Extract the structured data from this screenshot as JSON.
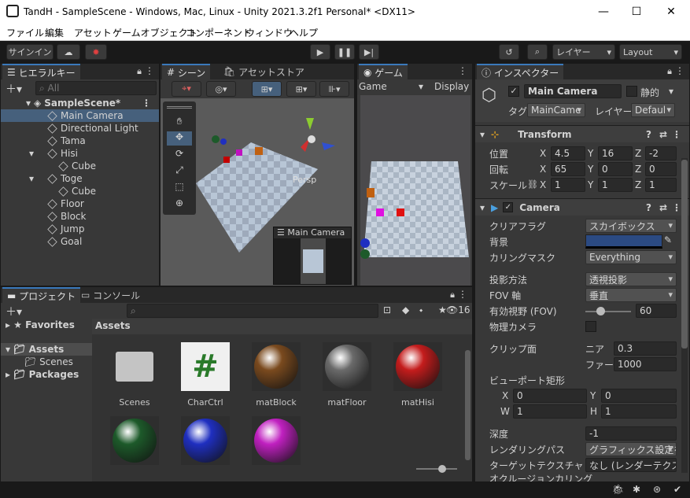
{
  "window": {
    "title": "TandH - SampleScene - Windows, Mac, Linux - Unity 2021.3.2f1 Personal* <DX11>",
    "minimize": "—",
    "maximize": "☐",
    "close": "✕"
  },
  "menu": [
    "ファイル",
    "編集",
    "アセット",
    "ゲームオブジェクト",
    "コンポーネント",
    "ウィンドウ",
    "ヘルプ"
  ],
  "toolbar": {
    "signin": "サインイン",
    "layers": "レイヤー",
    "layout": "Layout"
  },
  "hierarchy": {
    "tab": "ヒエラルキー",
    "search_placeholder": "All",
    "scene": "SampleScene*",
    "items": [
      {
        "label": "Main Camera",
        "indent": 1,
        "selected": true
      },
      {
        "label": "Directional Light",
        "indent": 1
      },
      {
        "label": "Tama",
        "indent": 1
      },
      {
        "label": "Hisi",
        "indent": 1,
        "expanded": true
      },
      {
        "label": "Cube",
        "indent": 2
      },
      {
        "label": "Toge",
        "indent": 1,
        "expanded": true
      },
      {
        "label": "Cube",
        "indent": 2
      },
      {
        "label": "Floor",
        "indent": 1
      },
      {
        "label": "Block",
        "indent": 1
      },
      {
        "label": "Jump",
        "indent": 1
      },
      {
        "label": "Goal",
        "indent": 1
      }
    ]
  },
  "scene": {
    "tab_scene": "シーン",
    "tab_store": "アセットストア",
    "persp": "Persp",
    "overlay_title": "Main Camera"
  },
  "game": {
    "tab": "ゲーム",
    "display_mode": "Game",
    "display": "Display"
  },
  "inspector": {
    "tab": "インスペクター",
    "object_name": "Main Camera",
    "static_label": "静的",
    "tag_label": "タグ",
    "tag_value": "MainCame",
    "layer_label": "レイヤー",
    "layer_value": "Defaul",
    "transform": {
      "title": "Transform",
      "position": {
        "label": "位置",
        "x": "4.5",
        "y": "16",
        "z": "-2"
      },
      "rotation": {
        "label": "回転",
        "x": "65",
        "y": "0",
        "z": "0"
      },
      "scale": {
        "label": "スケール",
        "x": "1",
        "y": "1",
        "z": "1"
      }
    },
    "camera": {
      "title": "Camera",
      "clear_flags": {
        "label": "クリアフラグ",
        "value": "スカイボックス"
      },
      "background": {
        "label": "背景",
        "color": "#2b4a82"
      },
      "culling_mask": {
        "label": "カリングマスク",
        "value": "Everything"
      },
      "projection": {
        "label": "投影方法",
        "value": "透視投影"
      },
      "fov_axis": {
        "label": "FOV 軸",
        "value": "垂直"
      },
      "fov": {
        "label": "有効視野 (FOV)",
        "value": "60"
      },
      "physical": {
        "label": "物理カメラ"
      },
      "clipping": {
        "label": "クリップ面",
        "near_label": "ニア",
        "near": "0.3",
        "far_label": "ファー",
        "far": "1000"
      },
      "viewport": {
        "label": "ビューポート矩形",
        "x": "0",
        "y": "0",
        "w": "1",
        "h": "1"
      },
      "depth": {
        "label": "深度",
        "value": "-1"
      },
      "render_path": {
        "label": "レンダリングパス",
        "value": "グラフィックス設定を使"
      },
      "target_texture": {
        "label": "ターゲットテクスチャ",
        "value": "なし (レンダーテクスチ"
      },
      "occlusion": {
        "label": "オクルージョンカリング"
      }
    }
  },
  "project": {
    "tab_project": "プロジェクト",
    "tab_console": "コンソール",
    "hidden_count": "16",
    "tree": [
      {
        "label": "Favorites",
        "bold": true
      },
      {
        "label": "Assets",
        "bold": true,
        "selected": true
      },
      {
        "label": "Scenes",
        "indent": 1
      },
      {
        "label": "Packages",
        "bold": true
      }
    ],
    "breadcrumb": "Assets",
    "assets": [
      {
        "name": "Scenes",
        "kind": "folder"
      },
      {
        "name": "CharCtrl",
        "kind": "script"
      },
      {
        "name": "matBlock",
        "kind": "sphere",
        "color": "#7a4a1e"
      },
      {
        "name": "matFloor",
        "kind": "sphere",
        "color": "#6a6a6a"
      },
      {
        "name": "matHisi",
        "kind": "sphere",
        "color": "#c41c1c"
      },
      {
        "name": "",
        "kind": "sphere",
        "color": "#1d5a2a"
      },
      {
        "name": "",
        "kind": "sphere",
        "color": "#1f2fc0"
      },
      {
        "name": "",
        "kind": "sphere",
        "color": "#c020c0"
      }
    ]
  }
}
